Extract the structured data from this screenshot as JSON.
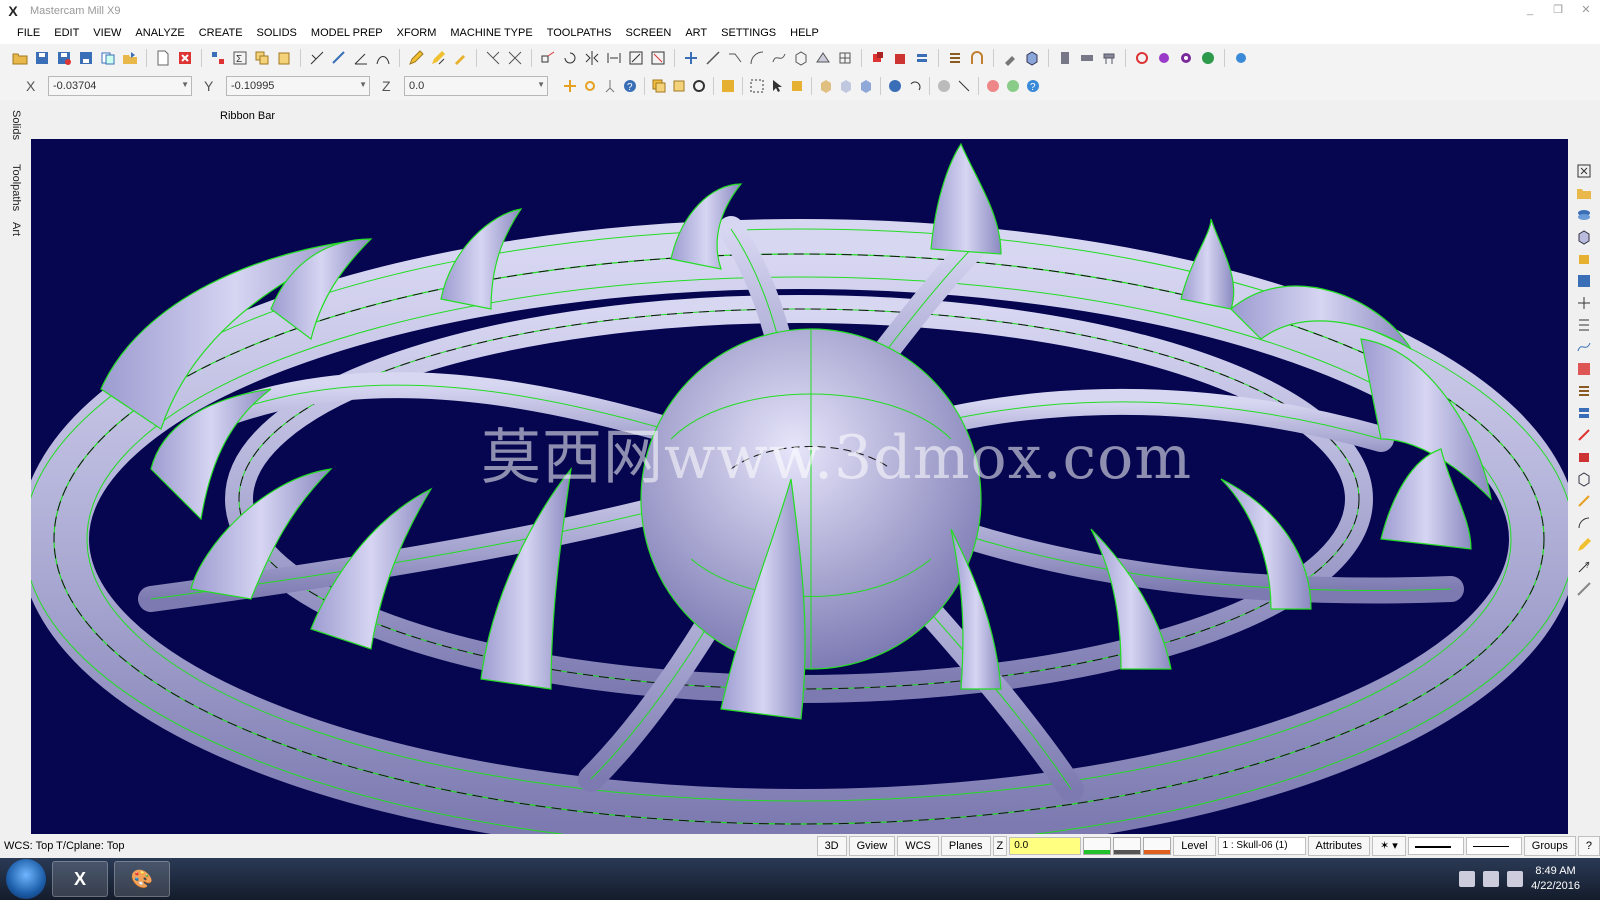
{
  "window": {
    "title": "Mastercam Mill X9",
    "controls": [
      "_",
      "❐",
      "✕"
    ]
  },
  "menu": [
    "FILE",
    "EDIT",
    "VIEW",
    "ANALYZE",
    "CREATE",
    "SOLIDS",
    "MODEL PREP",
    "XFORM",
    "MACHINE TYPE",
    "TOOLPATHS",
    "SCREEN",
    "ART",
    "SETTINGS",
    "HELP"
  ],
  "coords": {
    "x_label": "X",
    "x_value": "-0.03704",
    "y_label": "Y",
    "y_value": "-0.10995",
    "z_label": "Z",
    "z_value": "0.0"
  },
  "ribbon_label": "Ribbon Bar",
  "left_tabs": [
    "Solids",
    "Toolpaths",
    "Art"
  ],
  "watermark": "莫西网www.3dmox.com",
  "status": {
    "wcs_text": "WCS: Top  T/Cplane: Top",
    "btn_3d": "3D",
    "btn_gview": "Gview",
    "btn_wcs": "WCS",
    "btn_planes": "Planes",
    "z_label": "Z",
    "z_value": "0.0",
    "level_label": "Level",
    "level_value": "1 : Skull-06 (1)",
    "attributes": "Attributes",
    "groups": "Groups",
    "help": "?",
    "colors": {
      "point": "#22c22c",
      "line": "#555555",
      "surface": "#e06020"
    }
  },
  "taskbar": {
    "time": "8:49 AM",
    "date": "4/22/2016"
  },
  "model": {
    "surface_color": "#b9b8df",
    "wire_color": "#22dd22",
    "background": "#050550"
  }
}
